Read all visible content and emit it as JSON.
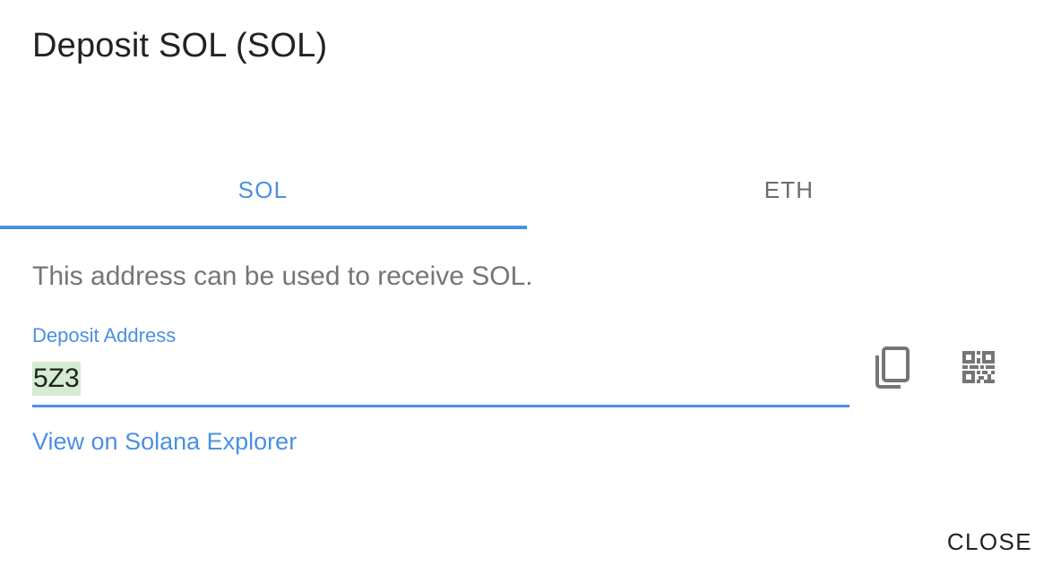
{
  "dialog": {
    "title": "Deposit SOL (SOL)"
  },
  "tabs": [
    {
      "label": "SOL",
      "active": true
    },
    {
      "label": "ETH",
      "active": false
    }
  ],
  "description": "This address can be used to receive SOL.",
  "deposit_field": {
    "label": "Deposit Address",
    "value": "5Z3"
  },
  "icons": {
    "copy": "copy-icon",
    "qr": "qr-code-icon"
  },
  "explorer_link": "View on Solana Explorer",
  "actions": {
    "close_label": "CLOSE"
  },
  "colors": {
    "accent": "#4a90e2",
    "text_primary": "#222222",
    "text_secondary": "#757575",
    "tab_inactive": "#6b6b6b",
    "highlight": "#d4ecd1",
    "icon": "#757575"
  }
}
